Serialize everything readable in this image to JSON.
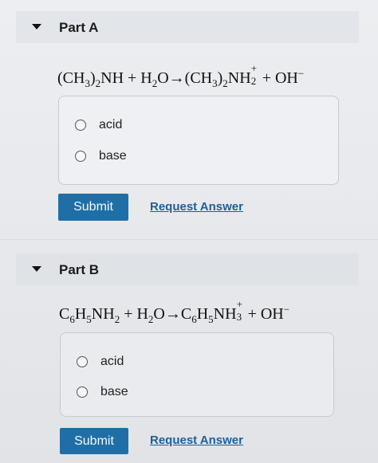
{
  "parts": [
    {
      "title": "Part A",
      "equation": {
        "segments": [
          "(CH",
          "3",
          ")",
          "2",
          "NH + H",
          "2",
          "O→(CH",
          "3",
          ")",
          "2",
          "NH",
          "+",
          "2",
          " + OH",
          "−"
        ]
      },
      "choices": [
        "acid",
        "base"
      ],
      "submit_label": "Submit",
      "request_label": "Request Answer"
    },
    {
      "title": "Part B",
      "equation": {
        "segments": [
          "C",
          "6",
          "H",
          "5",
          "NH",
          "2",
          " + H",
          "2",
          "O→C",
          "6",
          "H",
          "5",
          "NH",
          "+",
          "3",
          " + OH",
          "−"
        ]
      },
      "choices": [
        "acid",
        "base"
      ],
      "submit_label": "Submit",
      "request_label": "Request Answer"
    }
  ]
}
